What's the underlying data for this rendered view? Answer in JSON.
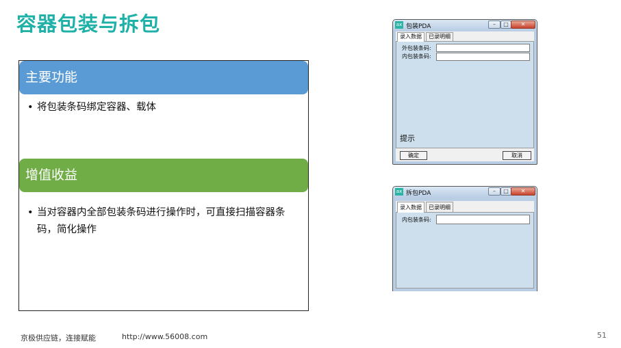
{
  "slide": {
    "title": "容器包装与拆包",
    "footer_company": "京极供应链，连接赋能",
    "footer_url": "http://www.56008.com",
    "page_number": "51"
  },
  "sections": [
    {
      "title": "主要功能",
      "bullet": "将包装条码绑定容器、载体"
    },
    {
      "title": "增值收益",
      "bullet": "当对容器内全部包装条码进行操作时，可直接扫描容器条码，简化操作"
    }
  ],
  "bullet_glyph": "•",
  "packing_window": {
    "icon_label": "ax",
    "title": "包装PDA",
    "tabs": [
      "录入数据",
      "已录明细"
    ],
    "fields": [
      {
        "label": "外包装条码:",
        "value": ""
      },
      {
        "label": "内包装条码:",
        "value": ""
      }
    ],
    "hint_label": "提示",
    "confirm_button": "确定",
    "cancel_button": "取消"
  },
  "unpacking_window": {
    "icon_label": "ax",
    "title": "拆包PDA",
    "tabs": [
      "录入数据",
      "已录明细"
    ],
    "fields": [
      {
        "label": "内包装条码:",
        "value": ""
      }
    ]
  },
  "window_controls": {
    "minimize": "–",
    "maximize": "□",
    "close": "✕"
  },
  "colors": {
    "title": "#1fb0a7",
    "header_blue": "#5b9bd5",
    "header_green": "#70ad47",
    "app_icon": "#2bb3a4"
  }
}
